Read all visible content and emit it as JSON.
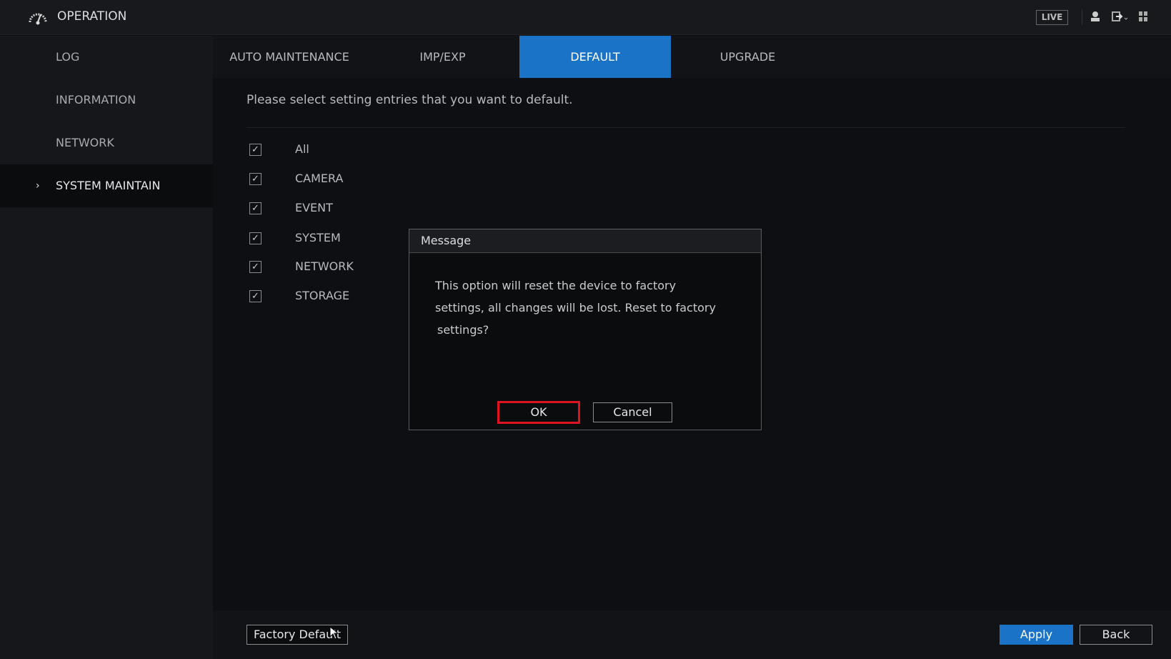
{
  "header": {
    "title": "OPERATION",
    "live_label": "LIVE"
  },
  "sidebar": {
    "items": [
      {
        "label": "LOG"
      },
      {
        "label": "INFORMATION"
      },
      {
        "label": "NETWORK"
      },
      {
        "label": "SYSTEM MAINTAIN",
        "active": true
      }
    ]
  },
  "tabs": [
    {
      "label": "AUTO MAINTENANCE"
    },
    {
      "label": "IMP/EXP"
    },
    {
      "label": "DEFAULT",
      "active": true
    },
    {
      "label": "UPGRADE"
    }
  ],
  "main": {
    "prompt": "Please select setting entries that you want to default.",
    "checkboxes": [
      {
        "label": "All",
        "checked": true
      },
      {
        "label": "CAMERA",
        "checked": true
      },
      {
        "label": "EVENT",
        "checked": true
      },
      {
        "label": "SYSTEM",
        "checked": true
      },
      {
        "label": "NETWORK",
        "checked": true
      },
      {
        "label": "STORAGE",
        "checked": true
      }
    ]
  },
  "dialog": {
    "title": "Message",
    "lines": [
      "This option will reset the device to factory",
      "settings, all changes will be lost. Reset to factory",
      "settings?"
    ],
    "ok": "OK",
    "cancel": "Cancel"
  },
  "footer": {
    "factory_default": "Factory Default",
    "apply": "Apply",
    "back": "Back"
  },
  "colors": {
    "accent": "#1a73c6",
    "highlight": "#e0141e"
  }
}
